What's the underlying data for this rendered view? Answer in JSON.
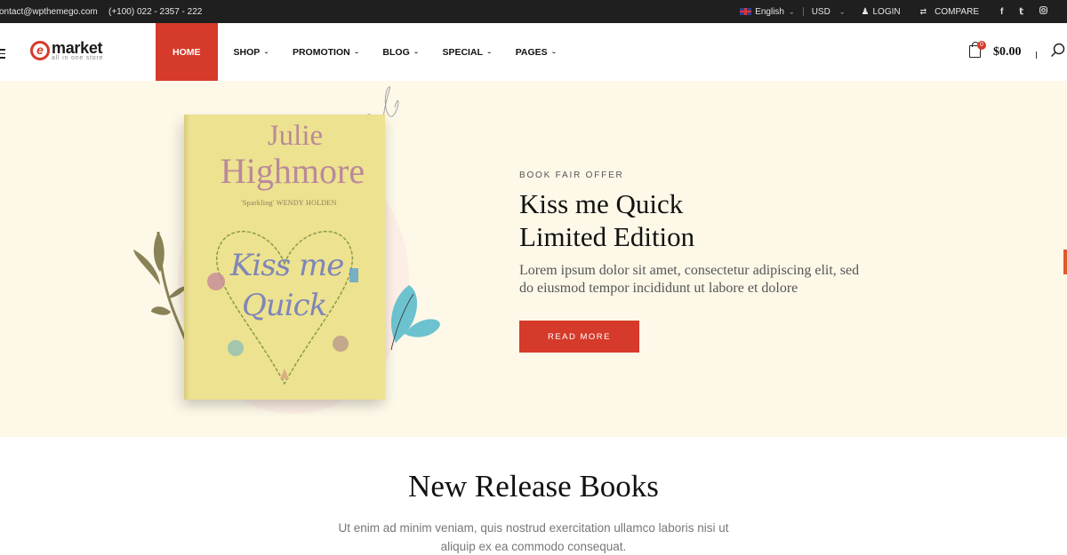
{
  "topbar": {
    "email": "contact@wpthemego.com",
    "phone": "(+100) 022 - 2357 - 222",
    "language": "English",
    "currency": "USD",
    "login": "LOGIN",
    "compare": "COMPARE",
    "social": [
      "facebook",
      "twitter",
      "instagram"
    ]
  },
  "header": {
    "logo_main": "market",
    "logo_letter": "e",
    "logo_tagline": "all in one store",
    "nav": [
      {
        "label": "HOME",
        "active": true
      },
      {
        "label": "SHOP",
        "dropdown": true
      },
      {
        "label": "PROMOTION",
        "dropdown": true
      },
      {
        "label": "BLOG",
        "dropdown": true
      },
      {
        "label": "SPECIAL",
        "dropdown": true
      },
      {
        "label": "PAGES",
        "dropdown": true
      }
    ],
    "cart_count": "0",
    "cart_total": "$0.00"
  },
  "hero": {
    "book": {
      "author_first": "Julie",
      "author_last": "Highmore",
      "quote": "'Sparkling' WENDY HOLDEN",
      "title_line1": "Kiss me",
      "title_line2": "Quick"
    },
    "tag": "BOOK FAIR OFFER",
    "title_line1": "Kiss me Quick",
    "title_line2": "Limited Edition",
    "description": "Lorem ipsum dolor sit amet, consectetur adipiscing elit, sed do eiusmod tempor incididunt ut labore et dolore",
    "button": "READ MORE"
  },
  "new_release": {
    "title": "New Release Books",
    "description": "Ut enim ad minim veniam, quis nostrud exercitation ullamco laboris nisi ut aliquip ex ea commodo consequat."
  },
  "colors": {
    "accent": "#d63a2a",
    "topbar_bg": "#1f1f1f",
    "hero_bg": "#fdf8e8"
  }
}
